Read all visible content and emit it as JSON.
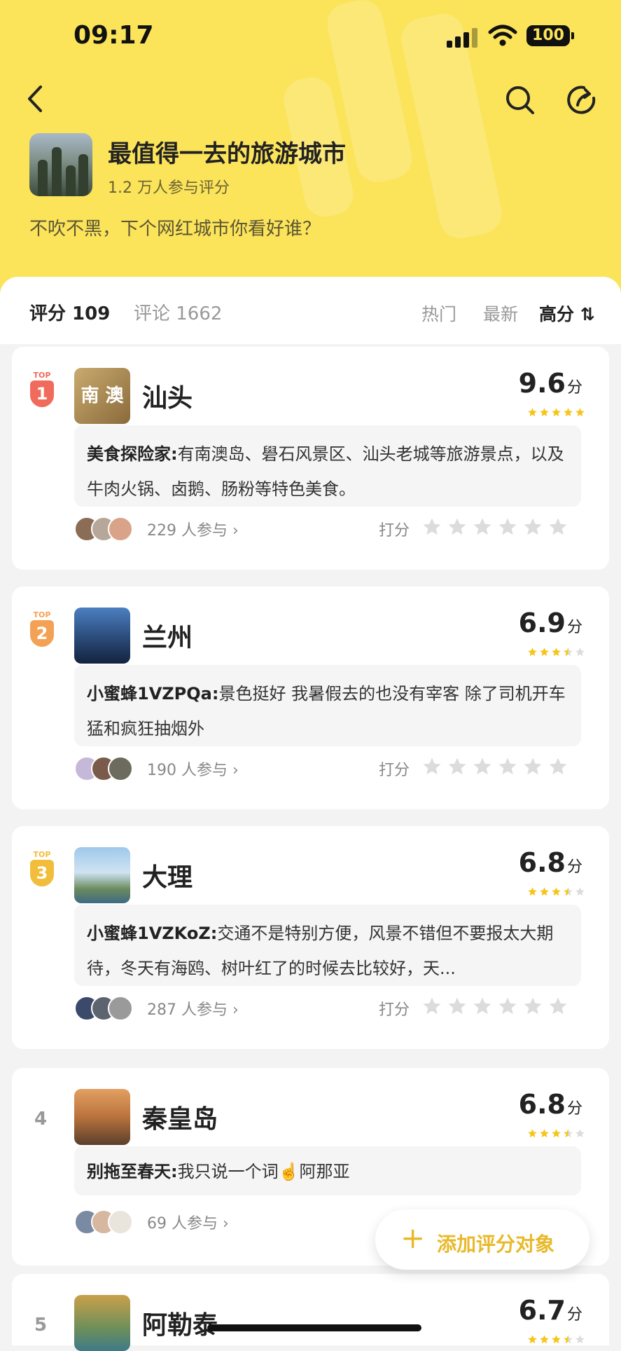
{
  "status_bar": {
    "time": "09:17",
    "battery": "100"
  },
  "header": {
    "title": "最值得一去的旅游城市",
    "subtitle": "1.2 万人参与评分",
    "description": "不吹不黑，下个网红城市你看好谁？"
  },
  "tabs": [
    {
      "label": "评分 109"
    },
    {
      "label": "评论 1662"
    }
  ],
  "sort_options": [
    {
      "label": "热门"
    },
    {
      "label": "最新"
    },
    {
      "label": "高分 ⇅"
    }
  ],
  "top_badge": "TOP",
  "unit_label": "分",
  "rate_label": "打分",
  "items": [
    {
      "rank": "1",
      "rank_color": "#f06b5b",
      "city": "汕头",
      "score": "9.6",
      "stars": 5,
      "comment_author": "美食探险家:",
      "comment_text": "有南澳岛、礐石风景区、汕头老城等旅游景点，以及牛肉火锅、卤鹅、肠粉等特色美食。",
      "joined": "229 人参与 ›",
      "thumb_text": "南 澳"
    },
    {
      "rank": "2",
      "rank_color": "#f3a255",
      "city": "兰州",
      "score": "6.9",
      "stars": 3.5,
      "comment_author": "小蜜蜂1VZPQa:",
      "comment_text": "景色挺好  我暑假去的也没有宰客  除了司机开车猛和疯狂抽烟外",
      "joined": "190 人参与 ›"
    },
    {
      "rank": "3",
      "rank_color": "#f1bd3a",
      "city": "大理",
      "score": "6.8",
      "stars": 3.5,
      "comment_author": "小蜜蜂1VZKoZ:",
      "comment_text": "交通不是特别方便，风景不错但不要报太大期待，冬天有海鸥、树叶红了的时候去比较好，天...",
      "joined": "287 人参与 ›"
    },
    {
      "rank": "4",
      "city": "秦皇岛",
      "score": "6.8",
      "stars": 3.5,
      "comment_author": "别拖至春天:",
      "comment_text": "我只说一个词☝️阿那亚",
      "joined": "69 人参与 ›"
    },
    {
      "rank": "5",
      "city": "阿勒泰",
      "score": "6.7",
      "stars": 3.5
    }
  ],
  "fab": {
    "plus": "+",
    "label": "添加评分对象"
  },
  "colors": {
    "brand_yellow": "#fbe35a",
    "accent": "#e8b92a",
    "star": "#f5c518"
  }
}
